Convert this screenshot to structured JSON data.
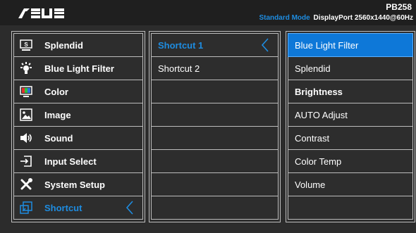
{
  "header": {
    "logo_text": "ASUS",
    "model": "PB258",
    "mode": "Standard Mode",
    "info": "DisplayPort 2560x1440@60Hz"
  },
  "main_menu": [
    {
      "label": "Splendid",
      "icon": "splendid-icon"
    },
    {
      "label": "Blue Light Filter",
      "icon": "blue-light-icon"
    },
    {
      "label": "Color",
      "icon": "color-icon"
    },
    {
      "label": "Image",
      "icon": "image-icon"
    },
    {
      "label": "Sound",
      "icon": "speaker-icon"
    },
    {
      "label": "Input Select",
      "icon": "input-select-icon"
    },
    {
      "label": "System Setup",
      "icon": "tools-icon"
    },
    {
      "label": "Shortcut",
      "icon": "shortcut-icon",
      "selected": true
    }
  ],
  "shortcut_menu": [
    {
      "label": "Shortcut 1",
      "selected": true
    },
    {
      "label": "Shortcut 2"
    }
  ],
  "options_menu": [
    {
      "label": "Blue Light Filter",
      "selected": true
    },
    {
      "label": "Splendid"
    },
    {
      "label": "Brightness",
      "bold": true
    },
    {
      "label": "AUTO Adjust"
    },
    {
      "label": "Contrast"
    },
    {
      "label": "Color Temp"
    },
    {
      "label": "Volume"
    }
  ],
  "colors": {
    "accent": "#1e8ce0",
    "selection": "#0e78d8",
    "background": "#2c2c2c"
  }
}
